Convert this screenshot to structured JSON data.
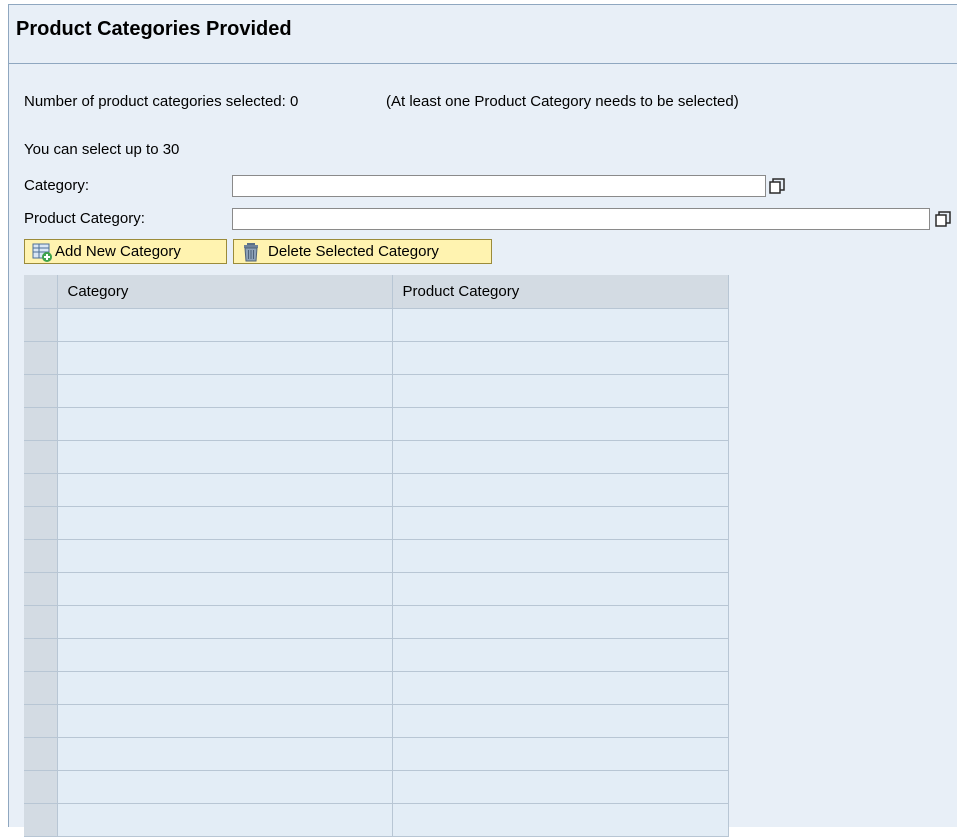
{
  "header": {
    "title": "Product Categories Provided"
  },
  "info": {
    "selected_count_text": "Number of product categories selected: 0",
    "requirement_text": "(At least one Product Category needs to be selected)",
    "limit_text": "You can select up to 30"
  },
  "form": {
    "category_label": "Category:",
    "category_value": "",
    "product_category_label": "Product Category:",
    "product_category_value": ""
  },
  "toolbar": {
    "add_label": "Add New Category",
    "delete_label": "Delete Selected Category"
  },
  "table": {
    "columns": [
      "Category",
      "Product Category"
    ],
    "rows": [
      [
        "",
        ""
      ],
      [
        "",
        ""
      ],
      [
        "",
        ""
      ],
      [
        "",
        ""
      ],
      [
        "",
        ""
      ],
      [
        "",
        ""
      ],
      [
        "",
        ""
      ],
      [
        "",
        ""
      ],
      [
        "",
        ""
      ],
      [
        "",
        ""
      ],
      [
        "",
        ""
      ],
      [
        "",
        ""
      ],
      [
        "",
        ""
      ],
      [
        "",
        ""
      ],
      [
        "",
        ""
      ],
      [
        "",
        ""
      ]
    ]
  },
  "icons": {
    "value_help": "value-help-icon",
    "add": "add-row-icon",
    "delete": "trash-icon"
  },
  "colors": {
    "panel_bg": "#e8eff7",
    "toolbar_button_bg": "#fff3b0",
    "table_header_bg": "#d3dbe3",
    "table_cell_bg": "#e3edf6"
  }
}
